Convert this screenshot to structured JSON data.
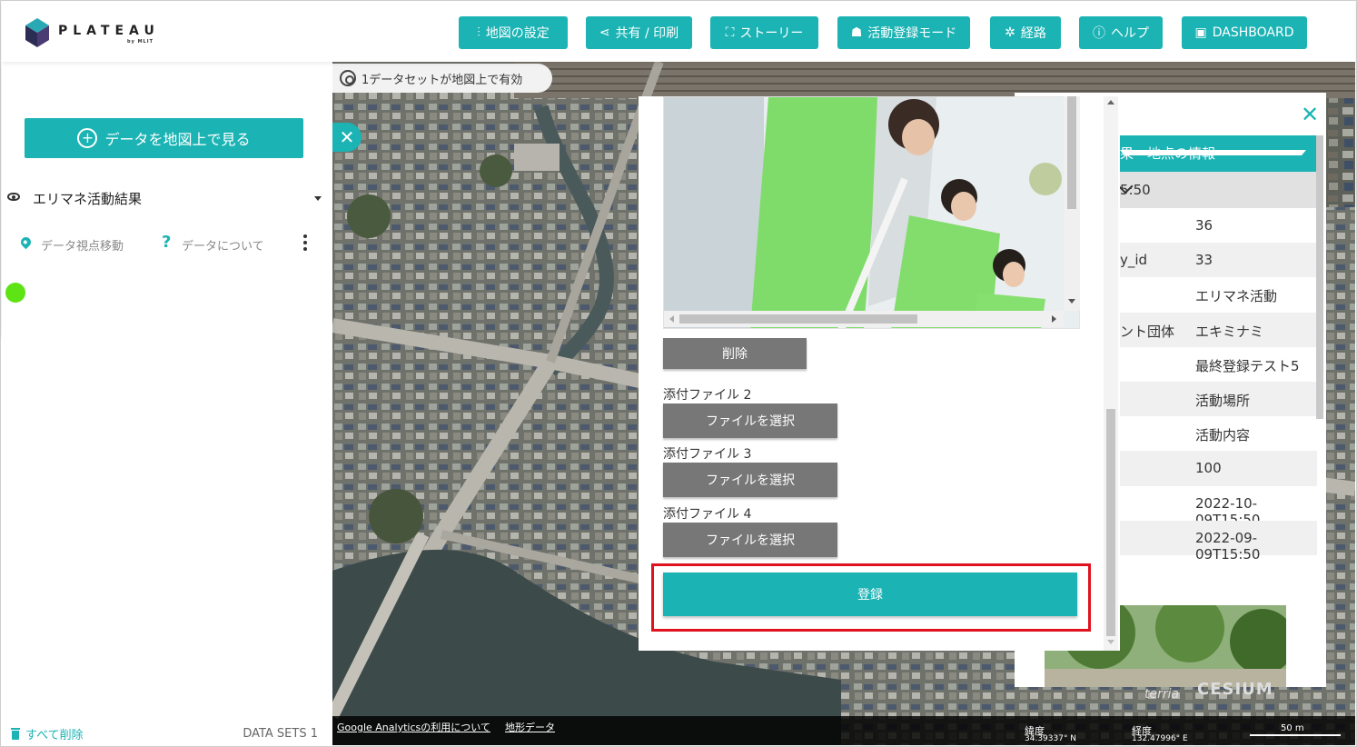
{
  "header": {
    "logo": {
      "name": "PLATEAU",
      "sub": "by MLIT"
    },
    "buttons": [
      {
        "label": "地図の設定",
        "icon": "sliders-icon"
      },
      {
        "label": "共有 / 印刷",
        "icon": "share-icon"
      },
      {
        "label": "ストーリー",
        "icon": "story-icon"
      },
      {
        "label": "活動登録モード",
        "icon": "group-icon"
      },
      {
        "label": "経路",
        "icon": "route-icon"
      },
      {
        "label": "ヘルプ",
        "icon": "help-icon"
      },
      {
        "label": "DASHBOARD",
        "icon": "book-icon"
      }
    ]
  },
  "left_panel": {
    "add_data_label": "データを地図上で見る",
    "dataset": {
      "title": "エリマネ活動結果",
      "action_zoom": "データ視点移動",
      "action_about": "データについて"
    },
    "remove_all_label": "すべて削除",
    "datasets_count_label": "DATA SETS 1"
  },
  "map": {
    "datasets_active_label": "1データセットが地図上で有効",
    "footer": {
      "analytics_link": "Google Analyticsの利用について",
      "terrain_link": "地形データ",
      "lat_label": "緯度",
      "lat_value": "34.39337° N",
      "lon_label": "経度",
      "lon_value": "132.47996° E",
      "scale_label": "50 m"
    },
    "branding": {
      "terria": "terria",
      "cesium": "CESIUM"
    }
  },
  "info_panel": {
    "header": "果 - 地点の情報",
    "time_row": "5:50",
    "rows": [
      {
        "key": "",
        "value": "36"
      },
      {
        "key": "y_id",
        "value": "33"
      },
      {
        "key": "",
        "value": "エリマネ活動"
      },
      {
        "key": "ント団体",
        "value": "エキミナミ"
      },
      {
        "key": "",
        "value": "最終登録テスト5"
      },
      {
        "key": "",
        "value": "活動場所"
      },
      {
        "key": "",
        "value": "活動内容"
      },
      {
        "key": "",
        "value": "100"
      },
      {
        "key": "",
        "value": "2022-10-09T15:50"
      },
      {
        "key": "",
        "value": "2022-09-09T15:50"
      }
    ]
  },
  "modal": {
    "delete_label": "削除",
    "attachments": [
      {
        "label": "添付ファイル 2",
        "button": "ファイルを選択"
      },
      {
        "label": "添付ファイル 3",
        "button": "ファイルを選択"
      },
      {
        "label": "添付ファイル 4",
        "button": "ファイルを選択"
      }
    ],
    "submit_label": "登録"
  },
  "colors": {
    "accent": "#1bb3b4",
    "highlight": "#e0121f",
    "dataset_dot": "#5ee314"
  }
}
